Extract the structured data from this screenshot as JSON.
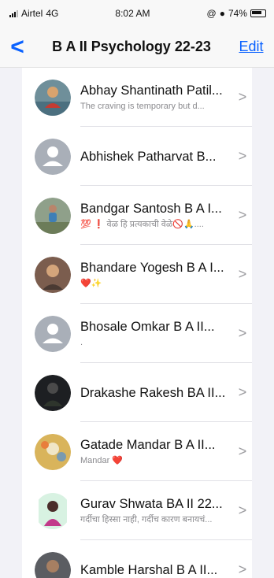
{
  "status": {
    "carrier": "Airtel",
    "network": "4G",
    "time": "8:02 AM",
    "battery": "74%"
  },
  "header": {
    "back_label": "<",
    "title": "B A II Psychology 22-23",
    "edit_label": "Edit"
  },
  "contacts": [
    {
      "name": "Abhay Shantinath Patil...",
      "subtitle": "The craving is temporary but d..."
    },
    {
      "name": "Abhishek Patharvat B...",
      "subtitle": ""
    },
    {
      "name": "Bandgar Santosh B A I...",
      "subtitle": "💯 ❗ वेळ हि प्रत्यकाची वेळे🚫🙏...."
    },
    {
      "name": "Bhandare Yogesh B A I...",
      "subtitle": "❤️✨"
    },
    {
      "name": "Bhosale Omkar B A II...",
      "subtitle": "."
    },
    {
      "name": "Drakashe Rakesh BA II...",
      "subtitle": ""
    },
    {
      "name": "Gatade Mandar B A II...",
      "subtitle": "Mandar ❤️"
    },
    {
      "name": "Gurav Shwata BA II 22...",
      "subtitle": "गर्दीचा हिस्सा नाही, गर्दीच कारण बनायचं..."
    },
    {
      "name": "Kamble Harshal B A II...",
      "subtitle": ""
    }
  ],
  "chevron": ">"
}
